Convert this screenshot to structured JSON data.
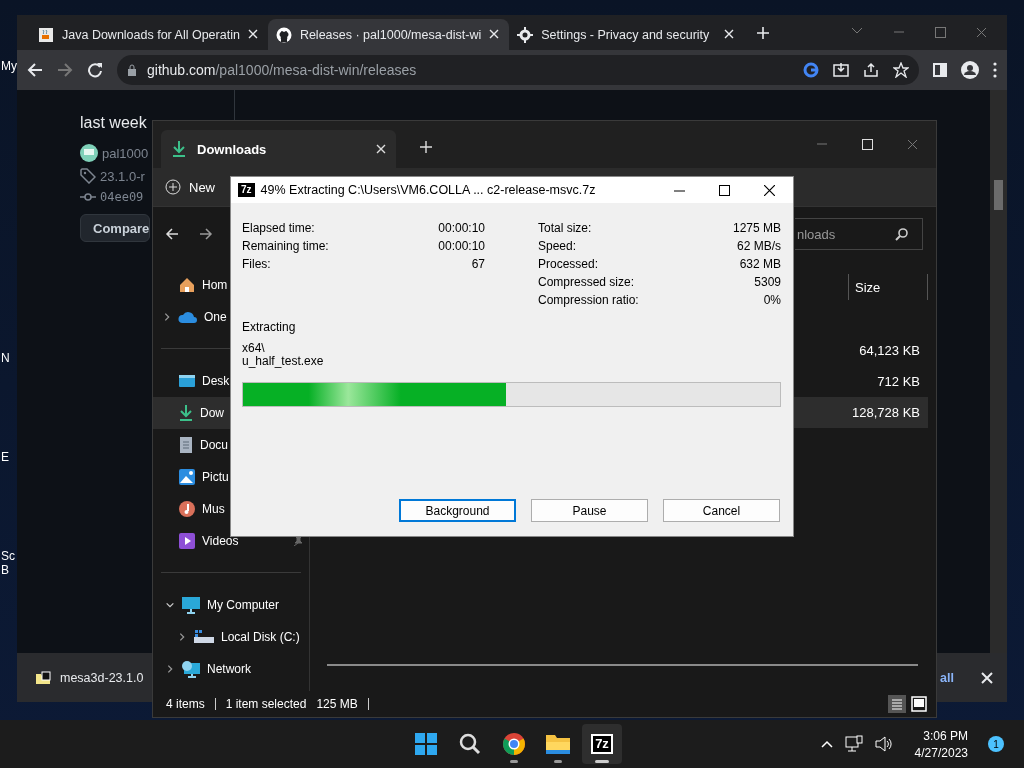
{
  "desktop_icons": [
    {
      "label": "My"
    },
    {
      "label": "N"
    },
    {
      "label": "E"
    },
    {
      "label": "Sc"
    },
    {
      "label": "B"
    }
  ],
  "browser": {
    "tabs": [
      {
        "title": "Java Downloads for All Operatin",
        "kind": "java",
        "selected": false
      },
      {
        "title": "Releases · pal1000/mesa-dist-wi",
        "kind": "github",
        "selected": true
      },
      {
        "title": "Settings - Privacy and security",
        "kind": "settings",
        "selected": false
      }
    ],
    "address": {
      "host": "github.com",
      "path": "/pal1000/mesa-dist-win/releases"
    },
    "release": {
      "time": "last week",
      "author": "pal1000",
      "tag": "23.1.0-r",
      "commit": "04ee09",
      "compare_button": "Compare"
    },
    "download_bar": {
      "file": "mesa3d-23.1.0",
      "show_all": "all"
    }
  },
  "explorer": {
    "title": "Downloads",
    "new_button": "New",
    "search_placeholder": "nloads",
    "size_header": "Size",
    "nav": [
      {
        "label": "Hom",
        "kind": "home",
        "selected": false
      },
      {
        "label": "One",
        "kind": "cloud",
        "selected": false,
        "expanded": false
      },
      {
        "label": "Desk",
        "kind": "desktop",
        "selected": false
      },
      {
        "label": "Dow",
        "kind": "downloads",
        "selected": true
      },
      {
        "label": "Docu",
        "kind": "documents",
        "selected": false
      },
      {
        "label": "Pictu",
        "kind": "pictures",
        "selected": false
      },
      {
        "label": "Mus",
        "kind": "music",
        "selected": false
      },
      {
        "label": "Videos",
        "kind": "videos",
        "selected": false,
        "pinned": true
      }
    ],
    "tree": [
      {
        "label": "My Computer",
        "kind": "computer",
        "expanded": true,
        "children": [
          {
            "label": "Local Disk (C:)",
            "kind": "disk",
            "expanded": false
          }
        ]
      },
      {
        "label": "Network",
        "kind": "network",
        "expanded": false
      }
    ],
    "rows": [
      {
        "size": "64,123 KB",
        "selected": false
      },
      {
        "size": "712 KB",
        "selected": false
      },
      {
        "size": "128,728 KB",
        "selected": true
      }
    ],
    "status": {
      "count": "4 items",
      "selection": "1 item selected",
      "size": "125 MB"
    }
  },
  "zip_dialog": {
    "app_icon": "7z",
    "title": "49% Extracting C:\\Users\\VM6.COLLA ... c2-release-msvc.7z",
    "left_stats": [
      {
        "label": "Elapsed time:",
        "value": "00:00:10"
      },
      {
        "label": "Remaining time:",
        "value": "00:00:10"
      },
      {
        "label": "Files:",
        "value": "67"
      }
    ],
    "right_stats": [
      {
        "label": "Total size:",
        "value": "1275 MB"
      },
      {
        "label": "Speed:",
        "value": "62 MB/s"
      },
      {
        "label": "Processed:",
        "value": "632 MB"
      },
      {
        "label": "Compressed size:",
        "value": "5309"
      },
      {
        "label": "Compression ratio:",
        "value": "0%"
      }
    ],
    "action": "Extracting",
    "folder": "x64\\",
    "file": "u_half_test.exe",
    "progress": {
      "level": 0.49
    },
    "buttons": [
      {
        "label": "Background",
        "focused": true
      },
      {
        "label": "Pause",
        "focused": false
      },
      {
        "label": "Cancel",
        "focused": false
      }
    ]
  },
  "taskbar": {
    "apps": [
      {
        "kind": "start",
        "running": false,
        "selected": false
      },
      {
        "kind": "search",
        "running": false,
        "selected": false
      },
      {
        "kind": "chrome",
        "running": true,
        "selected": false
      },
      {
        "kind": "files",
        "running": true,
        "selected": false
      },
      {
        "kind": "archiver",
        "label": "7z",
        "running": true,
        "selected": true
      }
    ],
    "time": "3:06 PM",
    "date": "4/27/2023",
    "notification_count": "1"
  }
}
